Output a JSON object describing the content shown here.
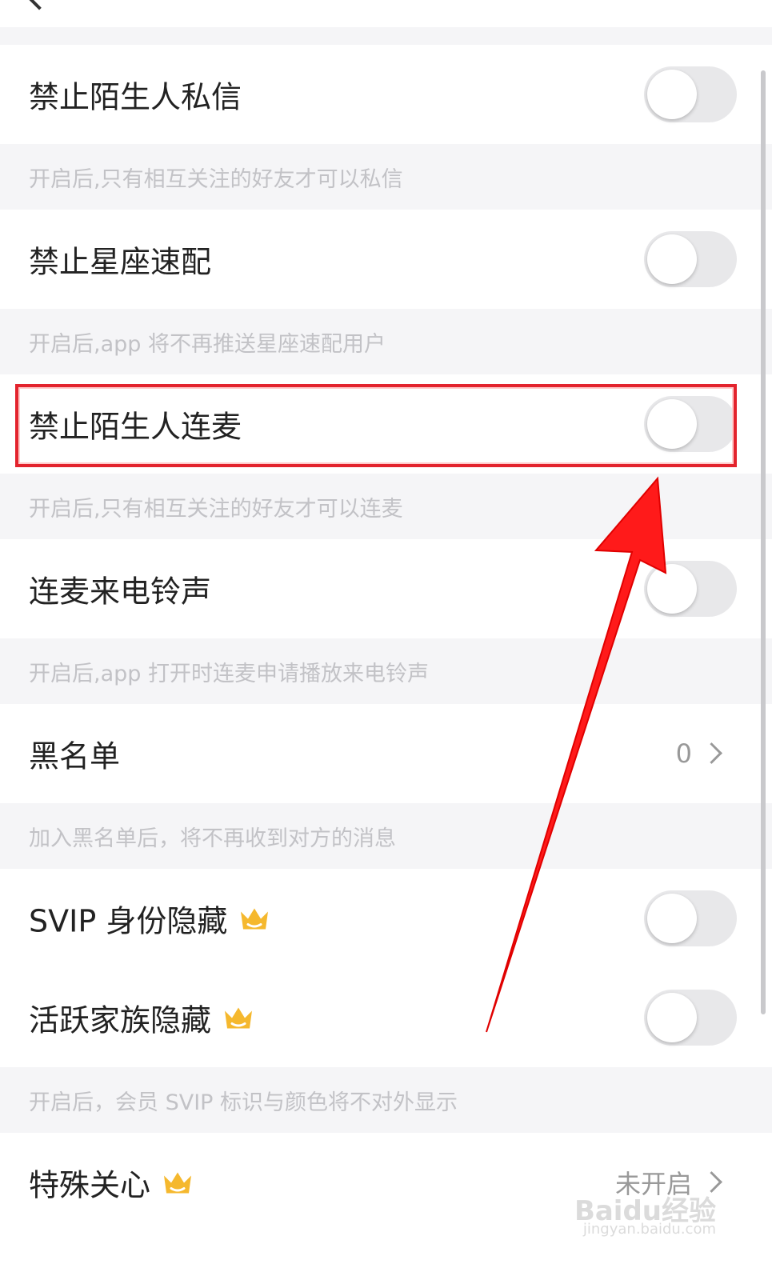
{
  "settings": {
    "block_stranger_dm": {
      "label": "禁止陌生人私信",
      "hint": "开启后,只有相互关注的好友才可以私信"
    },
    "block_zodiac_match": {
      "label": "禁止星座速配",
      "hint": "开启后,app 将不再推送星座速配用户"
    },
    "block_stranger_mic": {
      "label": "禁止陌生人连麦",
      "hint": "开启后,只有相互关注的好友才可以连麦"
    },
    "mic_ringtone": {
      "label": "连麦来电铃声",
      "hint": "开启后,app 打开时连麦申请播放来电铃声"
    },
    "blacklist": {
      "label": "黑名单",
      "value": "0",
      "hint": "加入黑名单后，将不再收到对方的消息"
    },
    "svip_hide": {
      "label": "SVIP 身份隐藏"
    },
    "family_hide": {
      "label": "活跃家族隐藏",
      "hint": "开启后，会员 SVIP 标识与颜色将不对外显示"
    },
    "special_care": {
      "label": "特殊关心",
      "value": "未开启"
    }
  },
  "toggles_state": "off",
  "colors": {
    "highlight": "#e3232d",
    "arrow": "#ff1a1a",
    "crown": "#f5b82e",
    "toggle_off": "#e8e8ea"
  },
  "icons": [
    "back-icon",
    "crown-icon",
    "chevron-right-icon"
  ],
  "watermark": {
    "brand": "Baidu经验",
    "url": "jingyan.baidu.com"
  }
}
